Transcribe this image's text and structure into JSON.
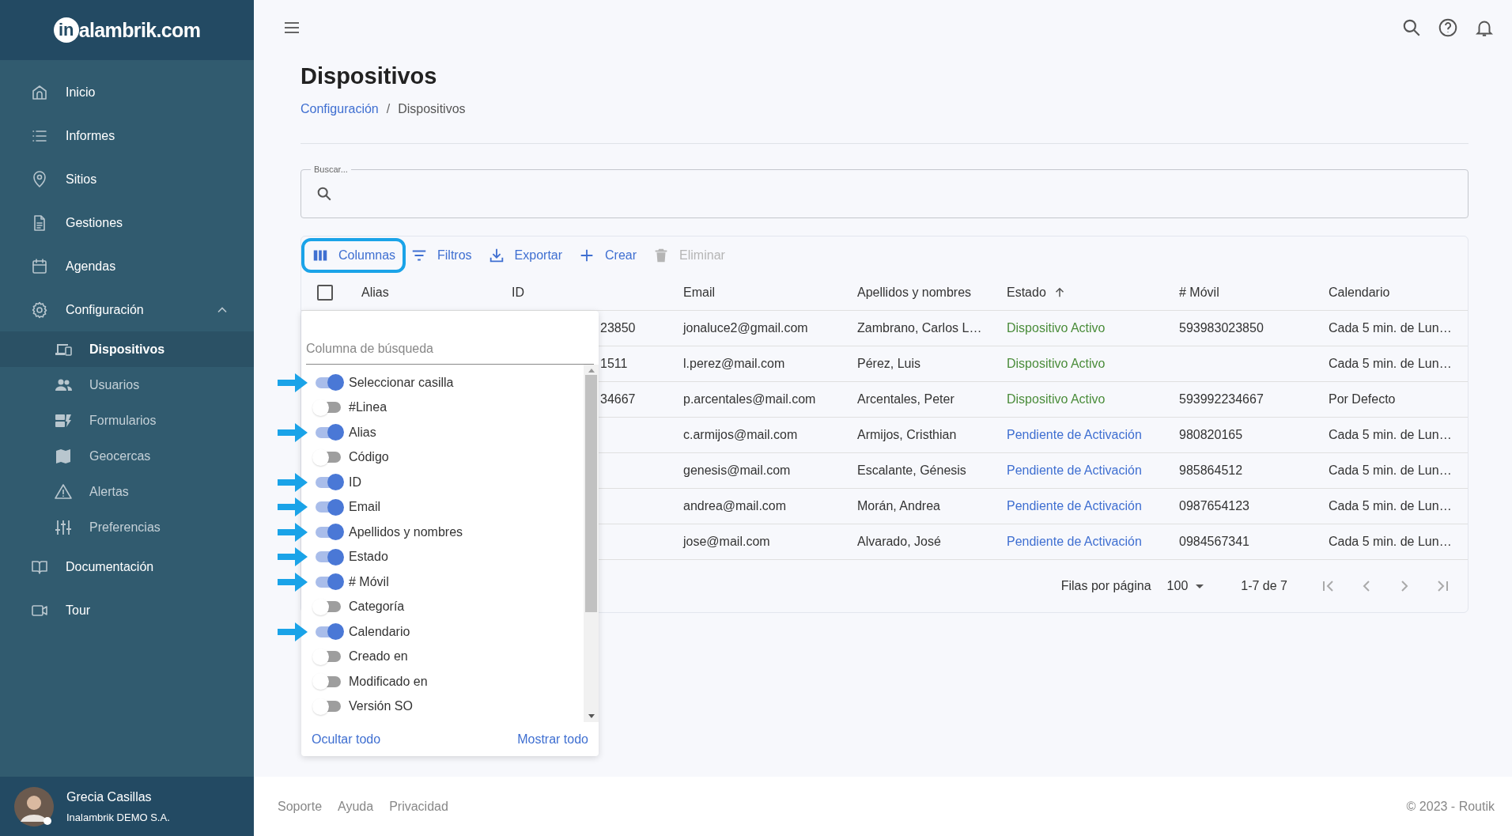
{
  "sidebar": {
    "logo": {
      "badge": "in",
      "text": "alambrik.com"
    },
    "items": [
      {
        "label": "Inicio",
        "selected": false
      },
      {
        "label": "Informes",
        "selected": false
      },
      {
        "label": "Sitios",
        "selected": false
      },
      {
        "label": "Gestiones",
        "selected": false
      },
      {
        "label": "Agendas",
        "selected": false
      },
      {
        "label": "Configuración",
        "selected": false,
        "expanded": true,
        "children": [
          {
            "label": "Dispositivos",
            "selected": true
          },
          {
            "label": "Usuarios",
            "selected": false
          },
          {
            "label": "Formularios",
            "selected": false
          },
          {
            "label": "Geocercas",
            "selected": false
          },
          {
            "label": "Alertas",
            "selected": false
          },
          {
            "label": "Preferencias",
            "selected": false
          }
        ]
      },
      {
        "label": "Documentación",
        "selected": false
      },
      {
        "label": "Tour",
        "selected": false
      }
    ],
    "user": {
      "name": "Grecia Casillas",
      "company": "Inalambrik DEMO S.A."
    }
  },
  "page": {
    "title": "Dispositivos",
    "breadcrumb": [
      {
        "label": "Configuración",
        "link": true
      },
      {
        "label": "Dispositivos",
        "link": false
      }
    ],
    "breadcrumb_separator": "/"
  },
  "search": {
    "label": "Buscar..."
  },
  "toolbar": [
    {
      "label": "Columnas",
      "disabled": false,
      "highlighted": true
    },
    {
      "label": "Filtros",
      "disabled": false,
      "highlighted": false
    },
    {
      "label": "Exportar",
      "disabled": false,
      "highlighted": false
    },
    {
      "label": "Crear",
      "disabled": false,
      "highlighted": false
    },
    {
      "label": "Eliminar",
      "disabled": true,
      "highlighted": false
    }
  ],
  "table": {
    "select_all_checked": false,
    "columns": [
      {
        "label": "Alias",
        "sorted": false
      },
      {
        "label": "ID",
        "sorted": false
      },
      {
        "label": "Email",
        "sorted": false
      },
      {
        "label": "Apellidos y nombres",
        "sorted": false
      },
      {
        "label": "Estado",
        "sorted": true
      },
      {
        "label": "# Móvil",
        "sorted": false
      },
      {
        "label": "Calendario",
        "sorted": false
      }
    ],
    "rows": [
      {
        "id": "23850",
        "email": "jonaluce2@gmail.com",
        "name": "Zambrano, Carlos L…",
        "status": "Dispositivo Activo",
        "active": true,
        "mobile": "593983023850",
        "calendar": "Cada 5 min. de Lun…"
      },
      {
        "id": "1511",
        "email": "l.perez@mail.com",
        "name": "Pérez, Luis",
        "status": "Dispositivo Activo",
        "active": true,
        "calendar": "Cada 5 min. de Lun…"
      },
      {
        "id": "34667",
        "email": "p.arcentales@mail.com",
        "name": "Arcentales, Peter",
        "status": "Dispositivo Activo",
        "active": true,
        "mobile": "593992234667",
        "calendar": "Por Defecto"
      },
      {
        "email": "c.armijos@mail.com",
        "name": "Armijos, Cristhian",
        "status": "Pendiente de Activación",
        "active": false,
        "mobile": "980820165",
        "calendar": "Cada 5 min. de Lun…"
      },
      {
        "email": "genesis@mail.com",
        "name": "Escalante, Génesis",
        "status": "Pendiente de Activación",
        "active": false,
        "mobile": "985864512",
        "calendar": "Cada 5 min. de Lun…"
      },
      {
        "email": "andrea@mail.com",
        "name": "Morán, Andrea",
        "status": "Pendiente de Activación",
        "active": false,
        "mobile": "0987654123",
        "calendar": "Cada 5 min. de Lun…"
      },
      {
        "email": "jose@mail.com",
        "name": "Alvarado, José",
        "status": "Pendiente de Activación",
        "active": false,
        "mobile": "0984567341",
        "calendar": "Cada 5 min. de Lun…"
      }
    ]
  },
  "pagination": {
    "rows_per_page_label": "Filas por página",
    "rows_per_page": "100",
    "range": "1-7 de 7"
  },
  "columns_panel": {
    "search_placeholder": "Columna de búsqueda",
    "items": [
      {
        "label": "Seleccionar casilla",
        "on": true,
        "marked": true
      },
      {
        "label": "#Linea",
        "on": false,
        "marked": false
      },
      {
        "label": "Alias",
        "on": true,
        "marked": true
      },
      {
        "label": "Código",
        "on": false,
        "marked": false
      },
      {
        "label": "ID",
        "on": true,
        "marked": true
      },
      {
        "label": "Email",
        "on": true,
        "marked": true
      },
      {
        "label": "Apellidos y nombres",
        "on": true,
        "marked": true
      },
      {
        "label": "Estado",
        "on": true,
        "marked": true
      },
      {
        "label": "# Móvil",
        "on": true,
        "marked": true
      },
      {
        "label": "Categoría",
        "on": false,
        "marked": false
      },
      {
        "label": "Calendario",
        "on": true,
        "marked": true
      },
      {
        "label": "Creado en",
        "on": false,
        "marked": false
      },
      {
        "label": "Modificado en",
        "on": false,
        "marked": false
      },
      {
        "label": "Versión SO",
        "on": false,
        "marked": false
      }
    ],
    "hide_all": "Ocultar todo",
    "show_all": "Mostrar todo"
  },
  "footer": {
    "links": [
      "Soporte",
      "Ayuda",
      "Privacidad"
    ],
    "copyright": "© 2023 - Routik"
  }
}
